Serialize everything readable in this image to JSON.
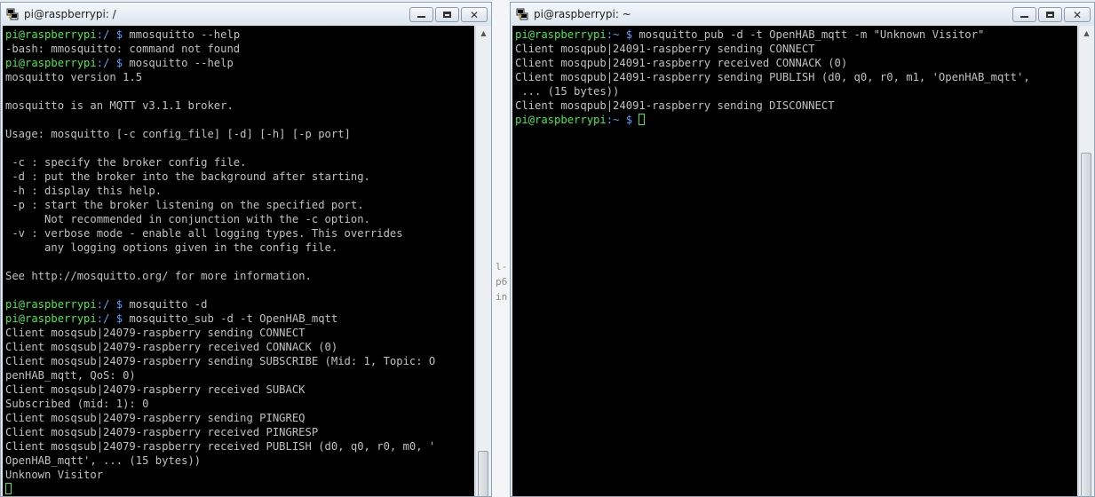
{
  "left_window": {
    "title": "pi@raspberrypi: /",
    "lines": [
      {
        "user": "pi@raspberrypi",
        "path": ":/ $ ",
        "cmd": "mmosquitto --help"
      },
      {
        "text": "-bash: mmosquitto: command not found"
      },
      {
        "user": "pi@raspberrypi",
        "path": ":/ $ ",
        "cmd": "mosquitto --help"
      },
      {
        "text": "mosquitto version 1.5"
      },
      {
        "text": ""
      },
      {
        "text": "mosquitto is an MQTT v3.1.1 broker."
      },
      {
        "text": ""
      },
      {
        "text": "Usage: mosquitto [-c config_file] [-d] [-h] [-p port]"
      },
      {
        "text": ""
      },
      {
        "text": " -c : specify the broker config file."
      },
      {
        "text": " -d : put the broker into the background after starting."
      },
      {
        "text": " -h : display this help."
      },
      {
        "text": " -p : start the broker listening on the specified port."
      },
      {
        "text": "      Not recommended in conjunction with the -c option."
      },
      {
        "text": " -v : verbose mode - enable all logging types. This overrides"
      },
      {
        "text": "      any logging options given in the config file."
      },
      {
        "text": ""
      },
      {
        "text": "See http://mosquitto.org/ for more information."
      },
      {
        "text": ""
      },
      {
        "user": "pi@raspberrypi",
        "path": ":/ $ ",
        "cmd": "mosquitto -d"
      },
      {
        "user": "pi@raspberrypi",
        "path": ":/ $ ",
        "cmd": "mosquitto_sub -d -t OpenHAB_mqtt"
      },
      {
        "text": "Client mosqsub|24079-raspberry sending CONNECT"
      },
      {
        "text": "Client mosqsub|24079-raspberry received CONNACK (0)"
      },
      {
        "text": "Client mosqsub|24079-raspberry sending SUBSCRIBE (Mid: 1, Topic: O"
      },
      {
        "text": "penHAB_mqtt, QoS: 0)"
      },
      {
        "text": "Client mosqsub|24079-raspberry received SUBACK"
      },
      {
        "text": "Subscribed (mid: 1): 0"
      },
      {
        "text": "Client mosqsub|24079-raspberry sending PINGREQ"
      },
      {
        "text": "Client mosqsub|24079-raspberry received PINGRESP"
      },
      {
        "text": "Client mosqsub|24079-raspberry received PUBLISH (d0, q0, r0, m0, '"
      },
      {
        "text": "OpenHAB_mqtt', ... (15 bytes))"
      },
      {
        "text": "Unknown Visitor"
      },
      {
        "cursor": true
      }
    ]
  },
  "right_window": {
    "title": "pi@raspberrypi: ~",
    "lines": [
      {
        "user": "pi@raspberrypi",
        "path": ":~ $ ",
        "cmd": "mosquitto_pub -d -t OpenHAB_mqtt -m \"Unknown Visitor\""
      },
      {
        "text": "Client mosqpub|24091-raspberry sending CONNECT"
      },
      {
        "text": "Client mosqpub|24091-raspberry received CONNACK (0)"
      },
      {
        "text": "Client mosqpub|24091-raspberry sending PUBLISH (d0, q0, r0, m1, 'OpenHAB_mqtt',"
      },
      {
        "text": " ... (15 bytes))"
      },
      {
        "text": "Client mosqpub|24091-raspberry sending DISCONNECT"
      },
      {
        "user": "pi@raspberrypi",
        "path": ":~ $ ",
        "cmd": "",
        "cursor": true
      }
    ]
  },
  "background_fragments": [
    "l-",
    "p6",
    "in"
  ],
  "colors": {
    "prompt_user": "#4ee64e",
    "prompt_path": "#5aa0ff",
    "terminal_text": "#c0c0c0",
    "terminal_bg": "#000000"
  }
}
